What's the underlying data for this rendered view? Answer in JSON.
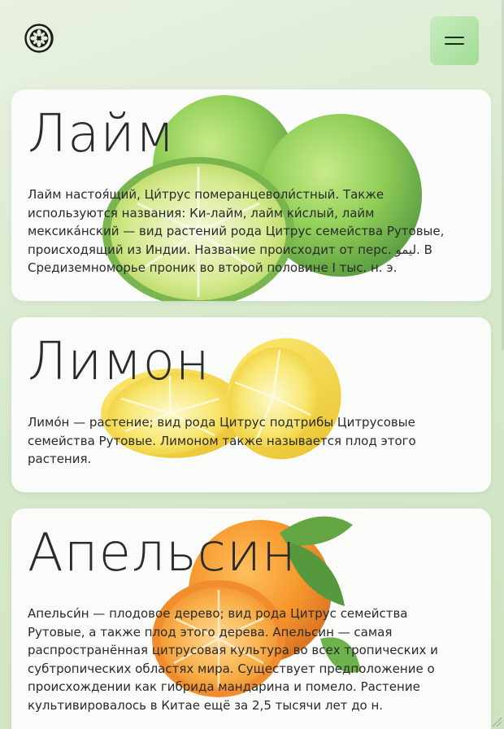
{
  "header": {
    "logo_icon": "citrus-logo-icon",
    "menu_icon": "hamburger-icon"
  },
  "cards": [
    {
      "title": "Лайм",
      "text": "Лайм настоя́щий, Ци́трус померанцеволи́стный. Также используются названия: Ки-лайм, лайм ки́слый, лайм мексика́нский — вид растений рода Цитрус семейства Рутовые, происходящий из Индии. Название происходит от перс. لیمو. В Средиземноморье проник во второй половине I тыс. н. э.",
      "image": "lime-fruits-image"
    },
    {
      "title": "Лимон",
      "text": "Лимо́н — растение; вид рода Цитрус подтрибы Цитрусовые семейства Рутовые. Лимоном также называется плод этого растения.",
      "image": "lemon-halves-image"
    },
    {
      "title": "Апельсин",
      "text": "Апельси́н — плодовое дерево; вид рода Цитрус семейства Рутовые, а также плод этого дерева. Апельсин — самая распространённая цитрусовая культура во всех тропических и субтропических областях мира. Существует предположение о происхождении как гибрида мандарина и помело. Растение культивировалось в Китае ещё за 2,5 тысячи лет до н.",
      "image": "orange-fruits-image"
    }
  ],
  "colors": {
    "background": "#d7e9cb",
    "card": "#fbfcfa",
    "menu_button": "#b5e4aa",
    "lime": "#7cc63a",
    "lemon": "#f5d51e",
    "orange": "#f48a12"
  }
}
